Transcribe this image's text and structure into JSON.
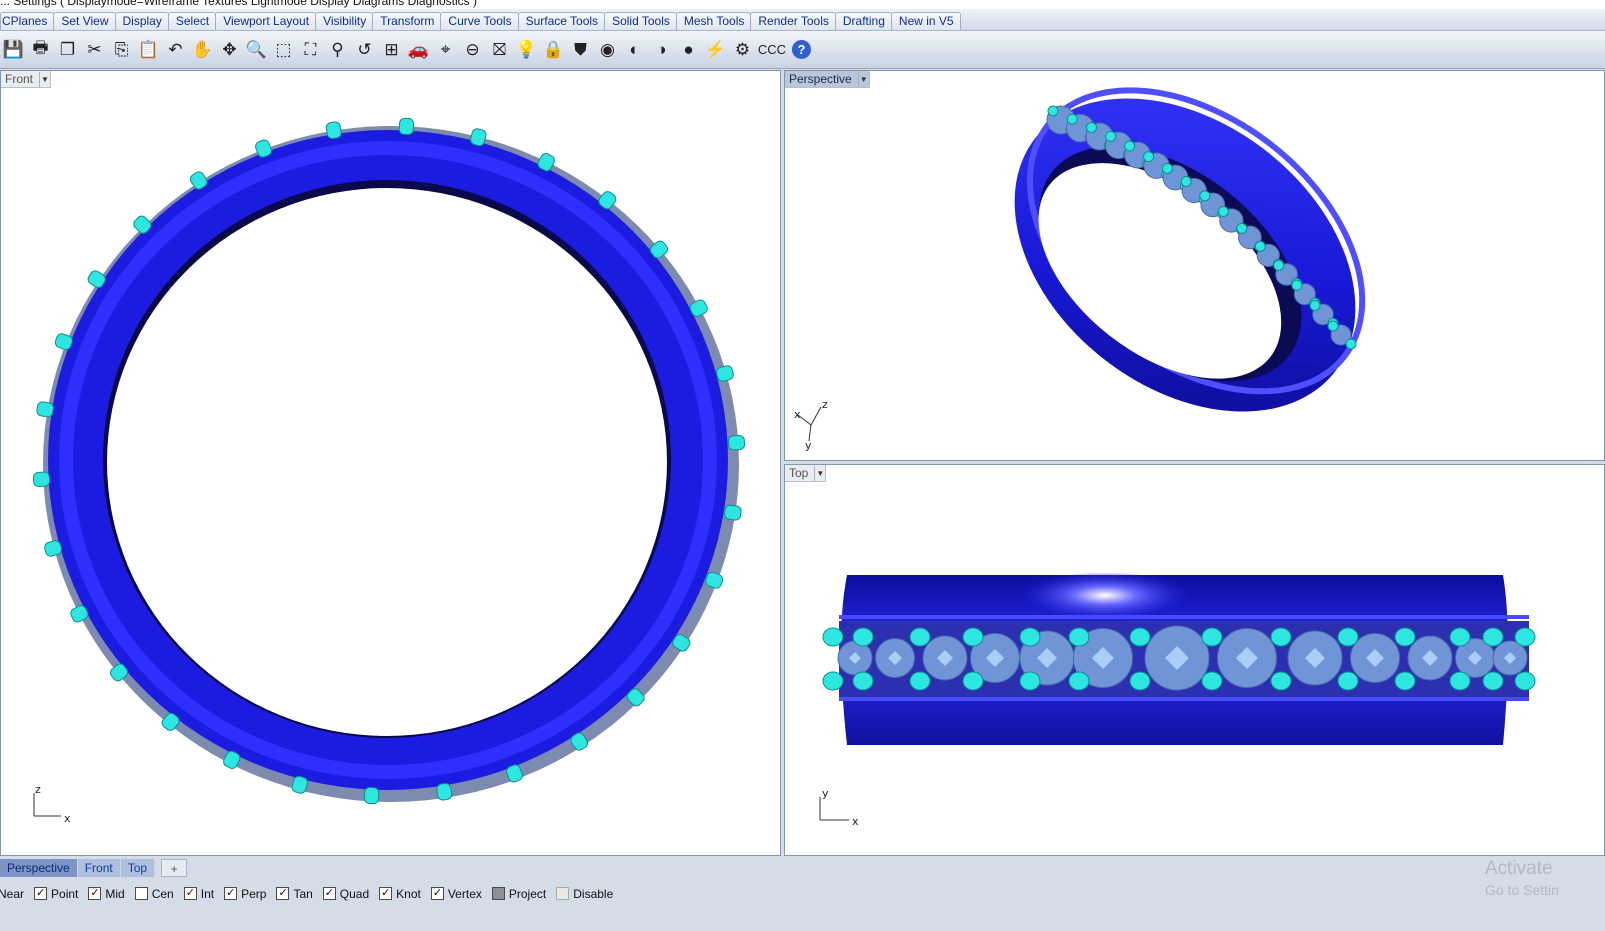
{
  "command_line": {
    "text": "... Settings ( Displaymode=Wireframe  Textures  Lightmode  Display  Diagrams  Diagnostics )"
  },
  "tabs": [
    {
      "label": "CPlanes"
    },
    {
      "label": "Set View"
    },
    {
      "label": "Display"
    },
    {
      "label": "Select"
    },
    {
      "label": "Viewport Layout"
    },
    {
      "label": "Visibility"
    },
    {
      "label": "Transform"
    },
    {
      "label": "Curve Tools"
    },
    {
      "label": "Surface Tools"
    },
    {
      "label": "Solid Tools"
    },
    {
      "label": "Mesh Tools"
    },
    {
      "label": "Render Tools"
    },
    {
      "label": "Drafting"
    },
    {
      "label": "New in V5"
    }
  ],
  "toolbar": {
    "buttons": [
      {
        "icon": "save-icon",
        "glyph": "💾"
      },
      {
        "icon": "print-icon",
        "glyph": "🖶"
      },
      {
        "icon": "copy-to-clipboard-icon",
        "glyph": "❐"
      },
      {
        "icon": "cut-icon",
        "glyph": "✂"
      },
      {
        "icon": "copy-icon",
        "glyph": "⎘"
      },
      {
        "icon": "paste-icon",
        "glyph": "📋"
      },
      {
        "icon": "undo-icon",
        "glyph": "↶"
      },
      {
        "icon": "pan-hand-icon",
        "glyph": "✋"
      },
      {
        "icon": "rotate-view-icon",
        "glyph": "✥"
      },
      {
        "icon": "zoom-icon",
        "glyph": "🔍"
      },
      {
        "icon": "zoom-window-icon",
        "glyph": "⬚"
      },
      {
        "icon": "zoom-extents-icon",
        "glyph": "⛶"
      },
      {
        "icon": "zoom-selected-icon",
        "glyph": "⚲"
      },
      {
        "icon": "undo-view-icon",
        "glyph": "↺"
      },
      {
        "icon": "four-viewports-icon",
        "glyph": "⊞"
      },
      {
        "icon": "car-icon",
        "glyph": "🚗"
      },
      {
        "icon": "named-views-icon",
        "glyph": "⌖"
      },
      {
        "icon": "cplane-icon",
        "glyph": "⊖"
      },
      {
        "icon": "select-objects-icon",
        "glyph": "⛝"
      },
      {
        "icon": "lightbulb-icon",
        "glyph": "💡"
      },
      {
        "icon": "lock-icon",
        "glyph": "🔒"
      },
      {
        "icon": "layer-icon",
        "glyph": "⛊"
      },
      {
        "icon": "color-wheel-icon",
        "glyph": "◉"
      },
      {
        "icon": "shaded-sphere-icon",
        "glyph": "◐"
      },
      {
        "icon": "rendered-sphere-icon",
        "glyph": "◑"
      },
      {
        "icon": "render-icon",
        "glyph": "●"
      },
      {
        "icon": "light-icon",
        "glyph": "⚡"
      },
      {
        "icon": "gear-icon",
        "glyph": "⚙"
      },
      {
        "icon": "ccc-label",
        "glyph": "CCC"
      },
      {
        "icon": "help-icon",
        "glyph": "?"
      }
    ]
  },
  "viewports": {
    "front": {
      "title": "Front",
      "axis_a": "z",
      "axis_b": "x"
    },
    "perspective": {
      "title": "Perspective",
      "axis_x": "x",
      "axis_y": "y",
      "axis_z": "z"
    },
    "top": {
      "title": "Top",
      "axis_a": "y",
      "axis_b": "x"
    }
  },
  "viewport_tabs": [
    {
      "label": "Perspective",
      "active": true
    },
    {
      "label": "Front",
      "active": false
    },
    {
      "label": "Top",
      "active": false
    }
  ],
  "viewport_tab_add": "+",
  "osnaps": [
    {
      "label": "Near",
      "state": "none"
    },
    {
      "label": "Point",
      "state": "checked"
    },
    {
      "label": "Mid",
      "state": "checked"
    },
    {
      "label": "Cen",
      "state": "unchecked"
    },
    {
      "label": "Int",
      "state": "checked"
    },
    {
      "label": "Perp",
      "state": "checked"
    },
    {
      "label": "Tan",
      "state": "checked"
    },
    {
      "label": "Quad",
      "state": "checked"
    },
    {
      "label": "Knot",
      "state": "checked"
    },
    {
      "label": "Vertex",
      "state": "checked"
    },
    {
      "label": "Project",
      "state": "filled"
    },
    {
      "label": "Disable",
      "state": "grey"
    }
  ],
  "watermark": {
    "line1": "Activate",
    "line2": "Go to Settin"
  },
  "colors": {
    "ring_blue": "#1a1adb",
    "prong_cyan": "#2ee6e0",
    "gem_blue": "#6f95d6"
  }
}
